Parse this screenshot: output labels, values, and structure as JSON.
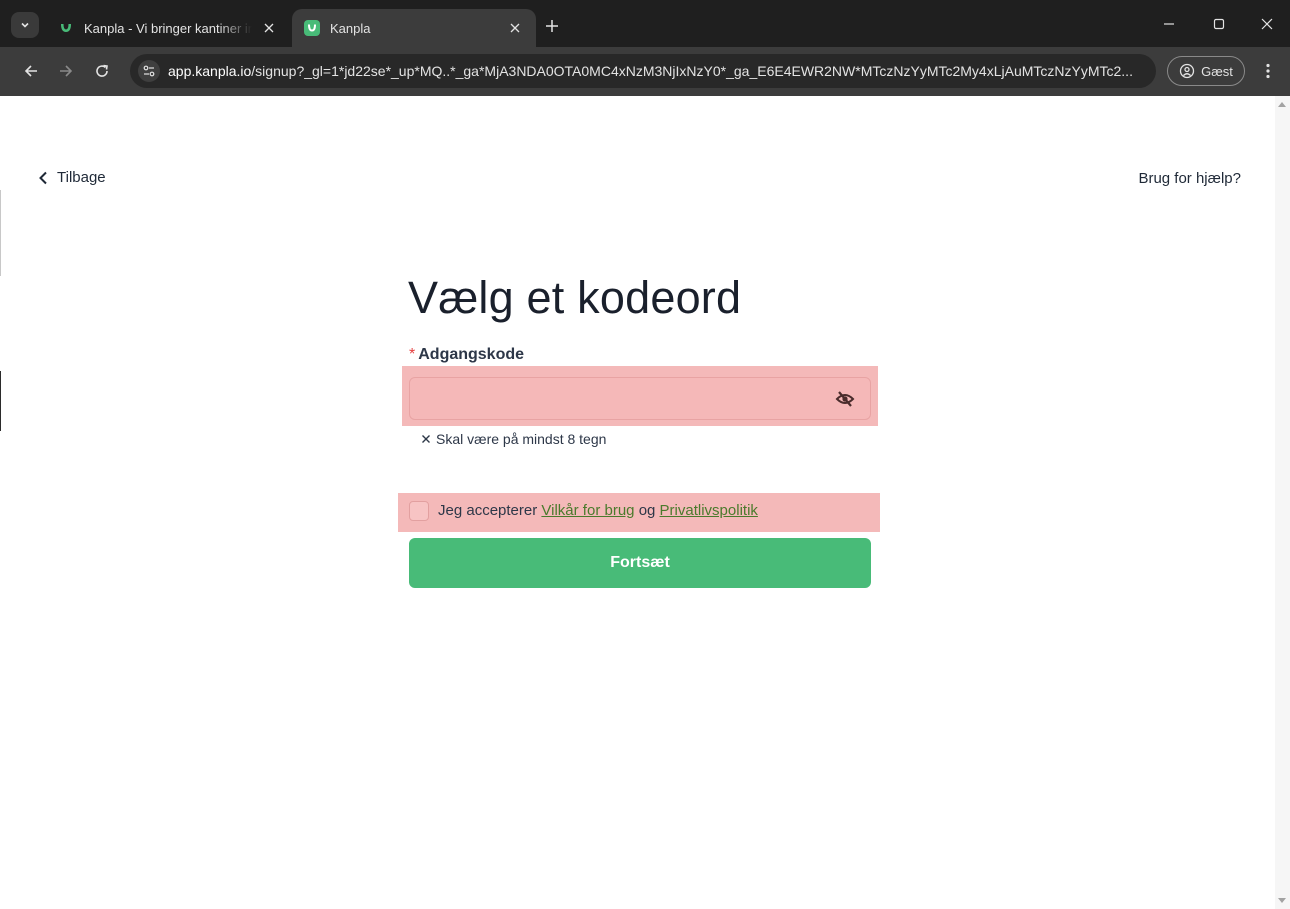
{
  "browser": {
    "tabs": [
      {
        "title": "Kanpla - Vi bringer kantiner ind",
        "active": false
      },
      {
        "title": "Kanpla",
        "active": true
      }
    ],
    "url_host": "app.kanpla.io",
    "url_path": "/signup?_gl=1*jd22se*_up*MQ..*_ga*MjA3NDA0OTA0MC4xNzM3NjIxNzY0*_ga_E6E4EWR2NW*MTczNzYyMTc2My4xLjAuMTczNzYyMTc2...",
    "profile_label": "Gæst",
    "icons": {
      "tab_menu": "chevron-down-icon",
      "new_tab": "plus-icon",
      "back": "arrow-left-icon",
      "forward": "arrow-right-icon",
      "reload": "reload-icon",
      "site_info": "tune-icon",
      "profile": "person-circle-icon",
      "menu": "kebab-menu-icon"
    }
  },
  "page": {
    "back_label": "Tilbage",
    "help_label": "Brug for hjælp?",
    "title": "Vælg et kodeord",
    "password": {
      "required_mark": "*",
      "label": "Adgangskode",
      "value": "",
      "placeholder": "",
      "toggle_icon": "eye-off-icon"
    },
    "hint": {
      "icon": "x-icon",
      "text": "Skal være på mindst 8 tegn"
    },
    "terms": {
      "prefix": "Jeg accepterer",
      "link1": "Vilkår for brug",
      "middle": "og",
      "link2": "Privatlivspolitik",
      "checked": false
    },
    "continue_label": "Fortsæt"
  },
  "colors": {
    "accent": "#48bb78",
    "error_highlight": "#f3b1b1",
    "required": "#e53e3e",
    "link": "#4a7a2c"
  }
}
